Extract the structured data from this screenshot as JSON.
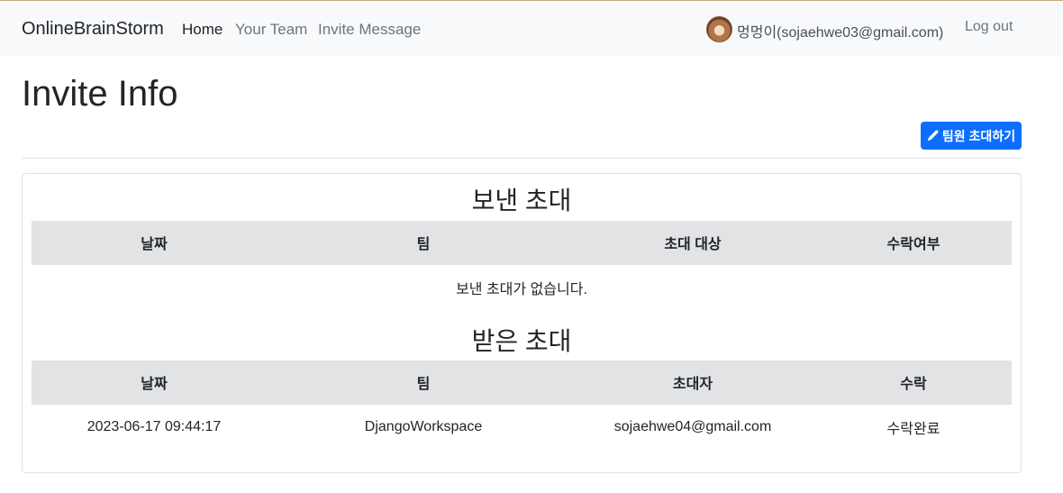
{
  "navbar": {
    "brand": "OnlineBrainStorm",
    "links": [
      "Home",
      "Your Team",
      "Invite Message"
    ],
    "user": "멍멍이(sojaehwe03@gmail.com)",
    "logout": "Log out"
  },
  "page": {
    "title": "Invite Info",
    "invite_button": "팀원 초대하기"
  },
  "sent": {
    "title": "보낸 초대",
    "columns": [
      "날짜",
      "팀",
      "초대 대상",
      "수락여부"
    ],
    "empty_message": "보낸 초대가 없습니다."
  },
  "received": {
    "title": "받은 초대",
    "columns": [
      "날짜",
      "팀",
      "초대자",
      "수락"
    ],
    "rows": [
      [
        "2023-06-17 09:44:17",
        "DjangoWorkspace",
        "sojaehwe04@gmail.com",
        "수락완료"
      ]
    ]
  },
  "colors": {
    "primary": "#0d6efd",
    "navbar_bg": "#f8f9fa",
    "table_header_bg": "#e2e3e5"
  },
  "icons": {
    "invite_button_icon": "pencil-icon"
  }
}
